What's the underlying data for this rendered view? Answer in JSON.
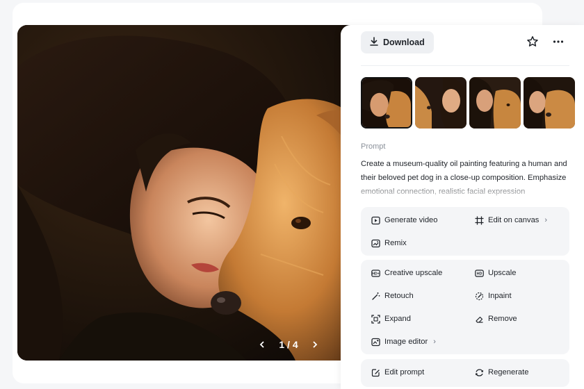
{
  "toolbar": {
    "download_label": "Download",
    "download_icon": "download-icon",
    "favorite_icon": "star-icon",
    "more_icon": "more-icon"
  },
  "viewer": {
    "current_page": 1,
    "total_pages": 4,
    "page_indicator": "1 / 4",
    "prev_icon": "chevron-left-icon",
    "next_icon": "chevron-right-icon"
  },
  "thumbnails": {
    "count": 4,
    "selected_index": 0
  },
  "prompt": {
    "label": "Prompt",
    "text": "Create a museum-quality oil painting featuring a human and their beloved pet dog in a close-up composition. Emphasize emotional connection, realistic facial expression"
  },
  "actions": {
    "group1": [
      {
        "label": "Generate video",
        "icon": "video-play-icon"
      },
      {
        "label": "Edit on canvas",
        "icon": "canvas-crop-icon",
        "chevron": "›"
      },
      {
        "label": "Remix",
        "icon": "remix-icon"
      }
    ],
    "group2": [
      {
        "label": "Creative upscale",
        "icon": "hd-plus-icon"
      },
      {
        "label": "Upscale",
        "icon": "hd-icon"
      },
      {
        "label": "Retouch",
        "icon": "magic-wand-icon"
      },
      {
        "label": "Inpaint",
        "icon": "inpaint-brush-icon"
      },
      {
        "label": "Expand",
        "icon": "expand-icon"
      },
      {
        "label": "Remove",
        "icon": "eraser-icon"
      },
      {
        "label": "Image editor",
        "icon": "palette-icon",
        "chevron": "›"
      }
    ],
    "group3": [
      {
        "label": "Edit prompt",
        "icon": "edit-prompt-icon"
      },
      {
        "label": "Regenerate",
        "icon": "regenerate-icon"
      }
    ]
  },
  "colors": {
    "page_bg": "#f5f6f8",
    "panel_bg": "#ffffff",
    "group_bg": "#f4f5f7",
    "download_bg": "#eef0f3",
    "text": "#1f2329",
    "muted": "#8a9099"
  }
}
